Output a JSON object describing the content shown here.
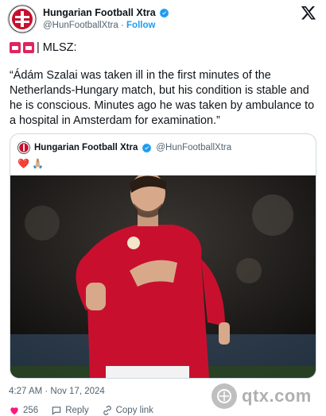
{
  "account": {
    "display_name": "Hungarian Football Xtra",
    "handle": "@HunFootballXtra",
    "separator": " · ",
    "follow_label": "Follow",
    "verified_icon": "verified-badge-icon"
  },
  "post": {
    "prefix_text": "| MLSZ:",
    "body": "“Ádám Szalai was taken ill in the first minutes of the Netherlands-Hungary match, but his condition is stable and he is conscious. Minutes ago he was taken by ambulance to a hospital in Amsterdam for examination.”",
    "timestamp": "4:27 AM · Nov 17, 2024"
  },
  "quoted": {
    "display_name": "Hungarian Football Xtra",
    "handle": "@HunFootballXtra",
    "emojis": [
      "❤️",
      "🙏🏼"
    ]
  },
  "actions": {
    "likes": "256",
    "reply_label": "Reply",
    "copy_label": "Copy link"
  },
  "watermark": {
    "text": "qtx.com"
  },
  "colors": {
    "accent": "#1d9bf0",
    "text": "#0f1419",
    "muted": "#536471",
    "border": "#cfd9de",
    "jersey": "#c8102e"
  }
}
